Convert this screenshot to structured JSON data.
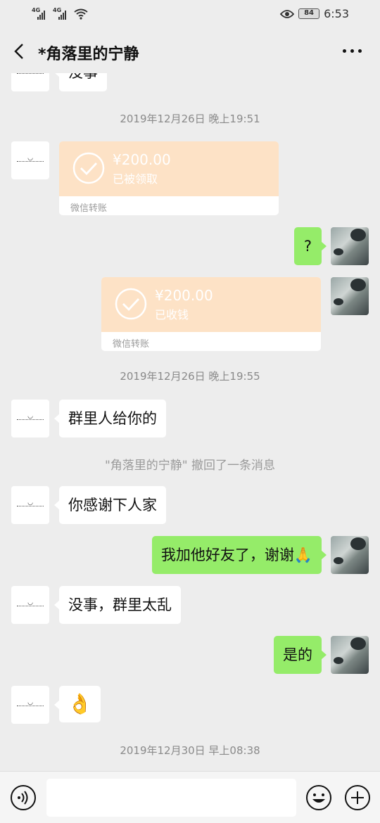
{
  "status_bar": {
    "signal1_label": "4G",
    "signal2_label": "4G",
    "battery": "84",
    "time": "6:53"
  },
  "header": {
    "title": "*角落里的宁静"
  },
  "messages": {
    "partial_top": "没事",
    "ts1": "2019年12月26日 晚上19:51",
    "transfer1": {
      "amount": "¥200.00",
      "status": "已被领取",
      "footer": "微信转账"
    },
    "q": "?",
    "transfer2": {
      "amount": "¥200.00",
      "status": "已收钱",
      "footer": "微信转账"
    },
    "ts2": "2019年12月26日 晚上19:55",
    "m1": "群里人给你的",
    "recall": "\"角落里的宁静\" 撤回了一条消息",
    "m2": "你感谢下人家",
    "m3": "我加他好友了，谢谢🙏",
    "m4": "没事，群里太乱",
    "m5": "是的",
    "m6": "👌",
    "ts3": "2019年12月30日 早上08:38"
  },
  "input": {
    "placeholder": ""
  },
  "icons": {
    "back": "back-arrow-icon",
    "more": "more-dots-icon",
    "voice": "voice-icon",
    "emoji": "smile-icon",
    "plus": "plus-icon",
    "check": "check-circle-icon"
  },
  "colors": {
    "background": "#ededed",
    "outgoing_bubble": "#95ec69",
    "incoming_bubble": "#ffffff",
    "transfer": "#fde2c6"
  }
}
